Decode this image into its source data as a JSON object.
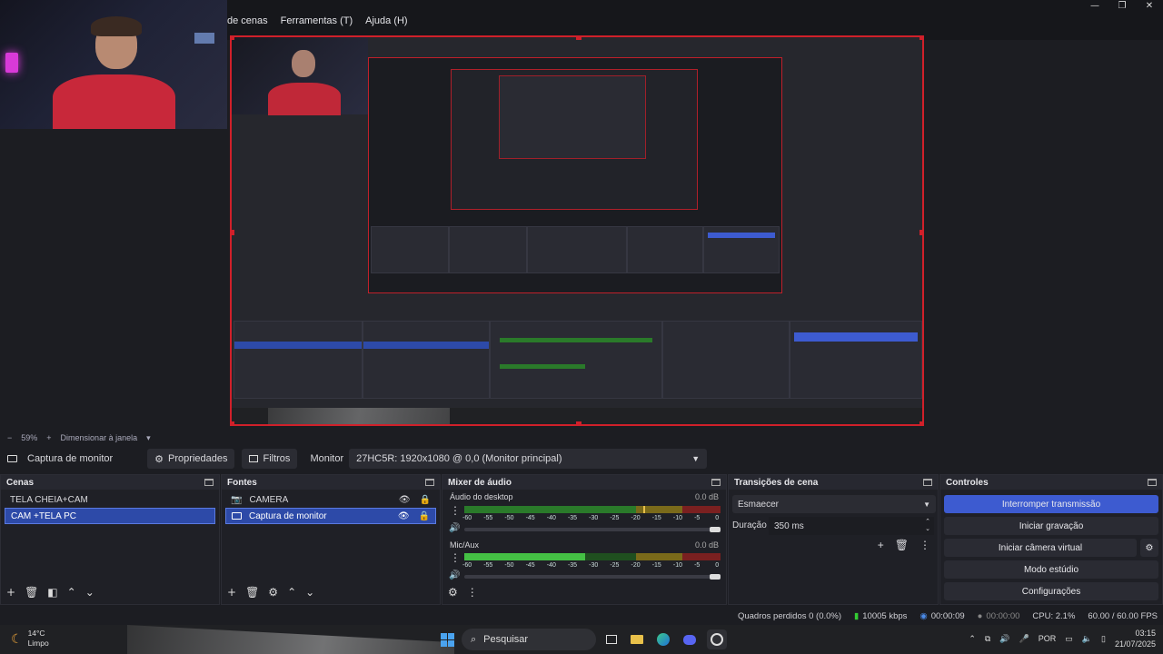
{
  "menu": {
    "items": [
      "de cenas",
      "Ferramentas (T)",
      "Ajuda (H)"
    ]
  },
  "window_controls": {
    "minimize": "—",
    "maximize": "❐",
    "close": "✕"
  },
  "zoom": {
    "level": "59%",
    "minus": "−",
    "plus": "+",
    "resize_label": "Dimensionar à janela"
  },
  "source_bar": {
    "source_name": "Captura de monitor",
    "properties_label": "Propriedades",
    "filters_label": "Filtros",
    "monitor_label": "Monitor",
    "monitor_value": "27HC5R: 1920x1080 @ 0,0 (Monitor principal)"
  },
  "panels": {
    "scenes": {
      "title": "Cenas",
      "items": [
        "TELA  CHEIA+CAM",
        "CAM +TELA  PC"
      ],
      "selected_index": 1
    },
    "sources": {
      "title": "Fontes",
      "items": [
        {
          "label": "CAMERA",
          "icon": "camera-icon"
        },
        {
          "label": "Captura de monitor",
          "icon": "monitor-icon"
        }
      ],
      "selected_index": 1
    },
    "mixer": {
      "title": "Mixer de áudio",
      "channels": [
        {
          "name": "Áudio do desktop",
          "db": "0.0 dB",
          "level": 0.7
        },
        {
          "name": "Mic/Aux",
          "db": "0.0 dB",
          "level": 0.47
        }
      ],
      "ticks": [
        "-60",
        "-55",
        "-50",
        "-45",
        "-40",
        "-35",
        "-30",
        "-25",
        "-20",
        "-15",
        "-10",
        "-5",
        "0"
      ]
    },
    "transitions": {
      "title": "Transições de cena",
      "transition": "Esmaecer",
      "duration_label": "Duração",
      "duration_value": "350 ms"
    },
    "controls": {
      "title": "Controles",
      "buttons": [
        "Interromper transmissão",
        "Iniciar gravação",
        "Iniciar câmera virtual",
        "Modo estúdio",
        "Configurações"
      ]
    }
  },
  "status": {
    "dropped_frames": "Quadros perdidos 0 (0.0%)",
    "bitrate": "10005 kbps",
    "stream_time": "00:00:09",
    "record_time": "00:00:00",
    "cpu": "CPU: 2.1%",
    "fps": "60.00 / 60.00 FPS"
  },
  "taskbar": {
    "weather_temp": "14°C",
    "weather_desc": "Limpo",
    "search_placeholder": "Pesquisar",
    "language": "POR",
    "time": "03:15",
    "date": "21/07/2025"
  },
  "colors": {
    "accent": "#3d5bd0",
    "selection": "#2d4aa8",
    "preview_border": "#d0202a"
  }
}
